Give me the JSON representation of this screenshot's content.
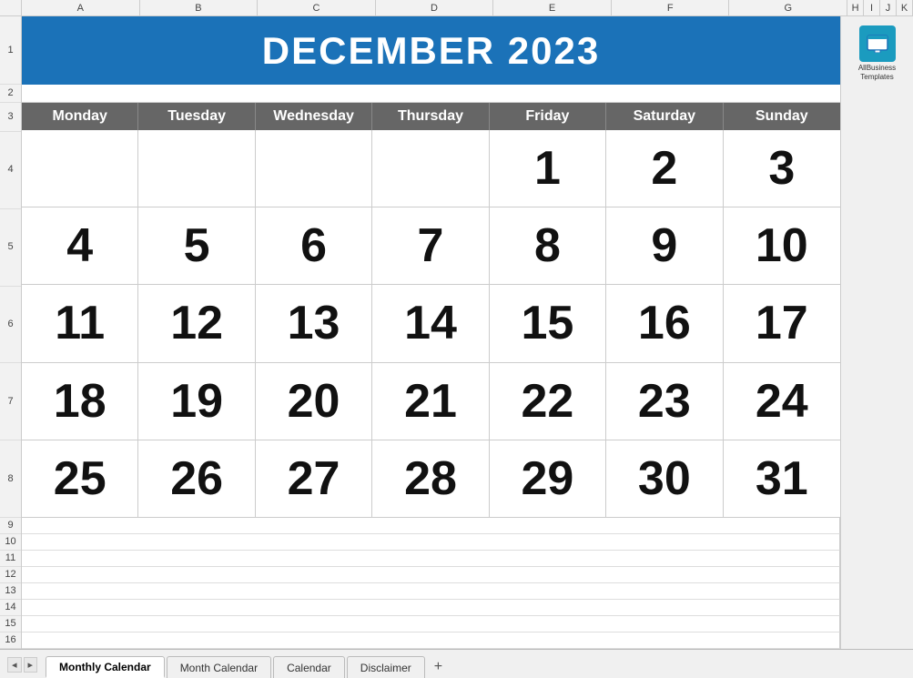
{
  "header": {
    "title": "DECEMBER 2023",
    "columns": [
      "A",
      "B",
      "C",
      "D",
      "E",
      "F",
      "G",
      "H",
      "I",
      "J",
      "K"
    ]
  },
  "calendar": {
    "month": "DECEMBER 2023",
    "days_of_week": [
      "Monday",
      "Tuesday",
      "Wednesday",
      "Thursday",
      "Friday",
      "Saturday",
      "Sunday"
    ],
    "weeks": [
      [
        "",
        "",
        "",
        "",
        "1",
        "2",
        "3"
      ],
      [
        "4",
        "5",
        "6",
        "7",
        "8",
        "9",
        "10"
      ],
      [
        "11",
        "12",
        "13",
        "14",
        "15",
        "16",
        "17"
      ],
      [
        "18",
        "19",
        "20",
        "21",
        "22",
        "23",
        "24"
      ],
      [
        "25",
        "26",
        "27",
        "28",
        "29",
        "30",
        "31"
      ]
    ]
  },
  "tabs": [
    {
      "label": "Monthly Calendar",
      "active": true
    },
    {
      "label": "Month Calendar",
      "active": false
    },
    {
      "label": "Calendar",
      "active": false
    },
    {
      "label": "Disclaimer",
      "active": false
    }
  ],
  "logo": {
    "text": "AllBusiness\nTemplates"
  },
  "row_numbers": [
    "1",
    "2",
    "3",
    "4",
    "5",
    "6",
    "7",
    "8",
    "9",
    "10",
    "11",
    "12",
    "13",
    "14",
    "15",
    "16"
  ]
}
